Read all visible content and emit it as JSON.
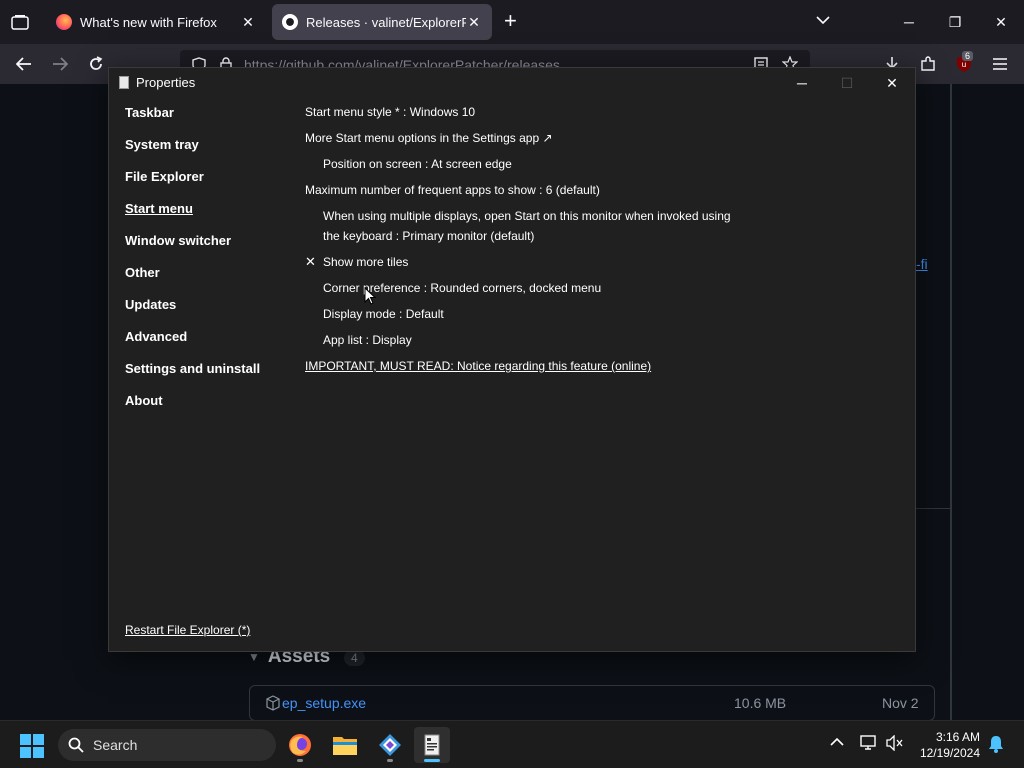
{
  "browser": {
    "tabs": [
      {
        "title": "What's new with Firefox",
        "active": false
      },
      {
        "title": "Releases · valinet/ExplorerPatcher",
        "active": true
      }
    ],
    "url": "https://github.com/valinet/ExplorerPatcher/releases",
    "extension_badge": "6"
  },
  "page": {
    "assets_label": "Assets",
    "assets_count": "4",
    "asset": {
      "name": "ep_setup.exe",
      "size": "10.6 MB",
      "date": "Nov 2"
    },
    "partial_link": "-fi"
  },
  "dialog": {
    "title": "Properties",
    "sidebar": [
      {
        "label": "Taskbar",
        "active": false
      },
      {
        "label": "System tray",
        "active": false
      },
      {
        "label": "File Explorer",
        "active": false
      },
      {
        "label": "Start menu",
        "active": true
      },
      {
        "label": "Window switcher",
        "active": false
      },
      {
        "label": "Other",
        "active": false
      },
      {
        "label": "Updates",
        "active": false
      },
      {
        "label": "Advanced",
        "active": false
      },
      {
        "label": "Settings and uninstall",
        "active": false
      },
      {
        "label": "About",
        "active": false
      }
    ],
    "restart_link": "Restart File Explorer (*)",
    "options": {
      "start_menu_style": "Start menu style * : Windows 10",
      "more_options": "More Start menu options in the Settings app ↗",
      "position": "Position on screen : At screen edge",
      "max_frequent": "Maximum number of frequent apps to show : 6 (default)",
      "multi_display_1": "When using multiple displays, open Start on this monitor when invoked using",
      "multi_display_2": "the keyboard : Primary monitor (default)",
      "show_more_tiles": "Show more tiles",
      "show_more_tiles_checked": true,
      "corner_pref": "Corner preference : Rounded corners, docked menu",
      "display_mode": "Display mode : Default",
      "app_list": "App list : Display",
      "important_link": "IMPORTANT, MUST READ: Notice regarding this feature (online)"
    }
  },
  "taskbar": {
    "search_label": "Search",
    "time": "3:16 AM",
    "date": "12/19/2024",
    "apps": [
      "firefox-icon",
      "file-explorer-icon",
      "vscode-insiders-icon",
      "properties-app-icon"
    ]
  },
  "colors": {
    "dialog_bg": "#202020",
    "link_blue": "#4493f8",
    "taskbar_bg": "#1c1c1c"
  }
}
